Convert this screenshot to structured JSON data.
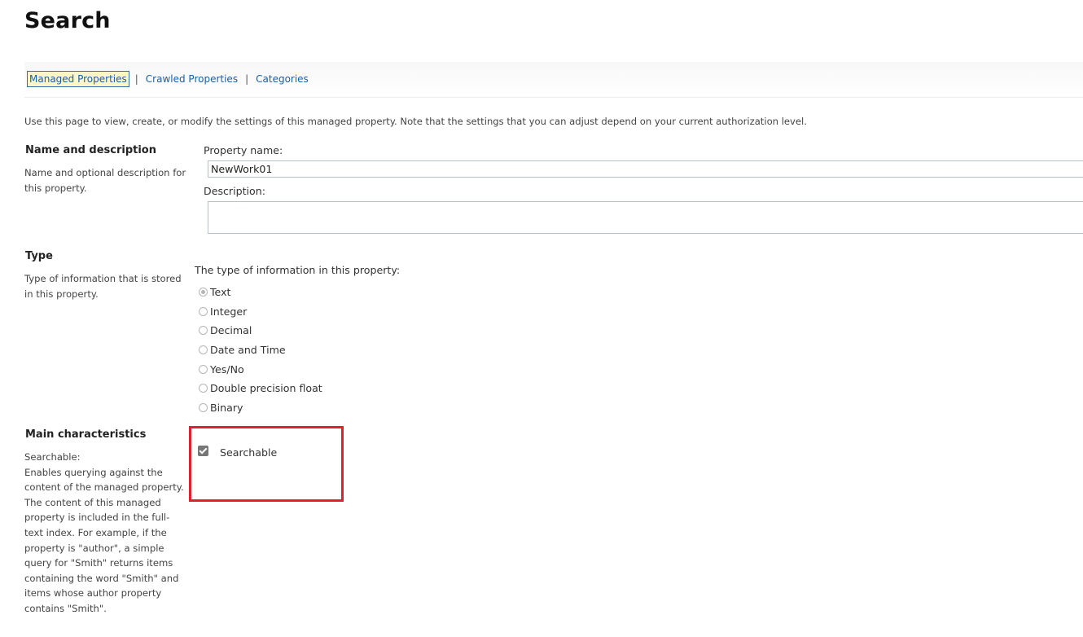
{
  "header": {
    "title": "Search"
  },
  "tabs": [
    {
      "label": "Managed Properties",
      "active": true
    },
    {
      "label": "Crawled Properties",
      "active": false
    },
    {
      "label": "Categories",
      "active": false
    }
  ],
  "tab_separator": "|",
  "intro_text": "Use this page to view, create, or modify the settings of this managed property. Note that the settings that you can adjust depend on your current authorization level.",
  "name_section": {
    "title": "Name and description",
    "description": "Name and optional description for this property.",
    "property_name_label": "Property name:",
    "property_name_value": "NewWork01",
    "description_label": "Description:",
    "description_value": ""
  },
  "type_section": {
    "title": "Type",
    "description": "Type of information that is stored in this property.",
    "prompt": "The type of information in this property:",
    "options": [
      "Text",
      "Integer",
      "Decimal",
      "Date and Time",
      "Yes/No",
      "Double precision float",
      "Binary"
    ],
    "selected": "Text"
  },
  "main_section": {
    "title": "Main characteristics",
    "searchable_heading": "Searchable:",
    "searchable_description": "Enables querying against the content of the managed property. The content of this managed property is included in the full-text index. For example, if the property is \"author\", a simple query for \"Smith\" returns items containing the word \"Smith\" and items whose author property contains \"Smith\".",
    "searchable_checkbox_label": "Searchable",
    "searchable_checked": true
  },
  "colors": {
    "link": "#1a5fa6",
    "active_tab_bg": "#fdf6c9",
    "highlight_border": "#e0202a"
  }
}
